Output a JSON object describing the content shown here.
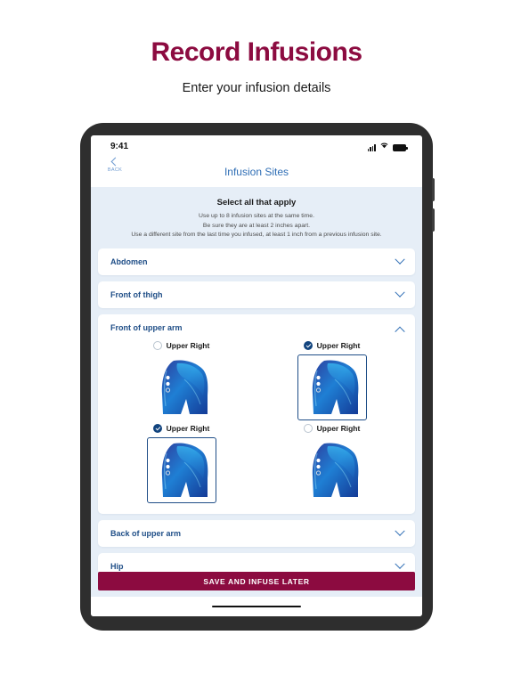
{
  "page": {
    "title": "Record Infusions",
    "subtitle": "Enter your infusion details"
  },
  "device": {
    "status_bar": {
      "time": "9:41",
      "signal_icon": "cellular-signal-icon",
      "wifi_icon": "wifi-icon",
      "battery_icon": "battery-icon"
    },
    "home_indicator": "home-indicator"
  },
  "nav": {
    "back_label": "BACK",
    "back_icon": "chevron-left-icon",
    "title": "Infusion Sites"
  },
  "intro": {
    "heading": "Select all that apply",
    "line1": "Use up to 8 infusion sites at the same time.",
    "line2": "Be sure they are at least 2 inches apart.",
    "line3": "Use a different site from the last time you infused, at least 1 inch from a previous infusion site."
  },
  "accordions": [
    {
      "label": "Abdomen",
      "expanded": false
    },
    {
      "label": "Front of thigh",
      "expanded": false
    },
    {
      "label": "Front of upper arm",
      "expanded": true
    },
    {
      "label": "Back of upper arm",
      "expanded": false
    },
    {
      "label": "Hip",
      "expanded": false
    }
  ],
  "site_options": [
    {
      "label": "Upper Right",
      "selected": false
    },
    {
      "label": "Upper Right",
      "selected": true
    },
    {
      "label": "Upper Right",
      "selected": true
    },
    {
      "label": "Upper Right",
      "selected": false
    }
  ],
  "footer": {
    "cta_label": "SAVE AND INFUSE LATER"
  },
  "colors": {
    "brand_maroon": "#8c0b40",
    "accent_blue": "#1f4e87",
    "nav_blue": "#2f6eb5",
    "content_bg": "#e6eef7",
    "selected_fill": "#12447e"
  }
}
